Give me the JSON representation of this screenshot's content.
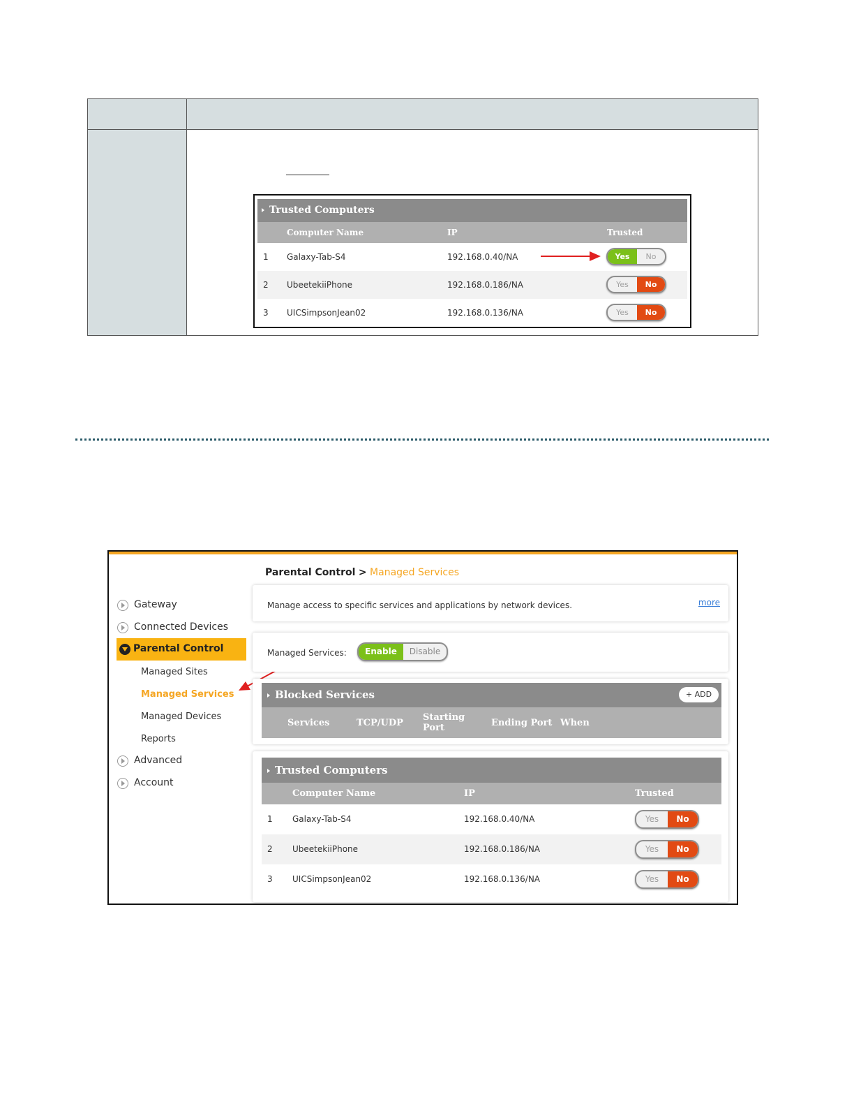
{
  "figure1": {
    "panel_title": "Trusted Computers",
    "columns": [
      "Computer Name",
      "IP",
      "Trusted"
    ],
    "rows": [
      {
        "num": "1",
        "name": "Galaxy-Tab-S4",
        "ip": "192.168.0.40/NA",
        "yes": "Yes",
        "no": "No",
        "trusted": true
      },
      {
        "num": "2",
        "name": "UbeetekiiPhone",
        "ip": "192.168.0.186/NA",
        "yes": "Yes",
        "no": "No",
        "trusted": false
      },
      {
        "num": "3",
        "name": "UICSimpsonJean02",
        "ip": "192.168.0.136/NA",
        "yes": "Yes",
        "no": "No",
        "trusted": false
      }
    ]
  },
  "figure2": {
    "breadcrumb": {
      "parent": "Parental Control",
      "sep": ">",
      "current": "Managed Services"
    },
    "nav": {
      "gateway": "Gateway",
      "connected_devices": "Connected Devices",
      "parental_control": "Parental Control",
      "sub": [
        "Managed Sites",
        "Managed Services",
        "Managed Devices",
        "Reports"
      ],
      "advanced": "Advanced",
      "account": "Account"
    },
    "description": "Manage access to specific services and applications by network devices.",
    "more_link": "more",
    "managed_services_label": "Managed Services:",
    "enable_label": "Enable",
    "disable_label": "Disable",
    "blocked": {
      "title": "Blocked Services",
      "add_label": "+ ADD",
      "columns": [
        "Services",
        "TCP/UDP",
        "Starting Port",
        "Ending Port",
        "When"
      ]
    },
    "trusted": {
      "title": "Trusted Computers",
      "columns": [
        "Computer Name",
        "IP",
        "Trusted"
      ],
      "rows": [
        {
          "num": "1",
          "name": "Galaxy-Tab-S4",
          "ip": "192.168.0.40/NA",
          "yes": "Yes",
          "no": "No",
          "trusted": false
        },
        {
          "num": "2",
          "name": "UbeetekiiPhone",
          "ip": "192.168.0.186/NA",
          "yes": "Yes",
          "no": "No",
          "trusted": false
        },
        {
          "num": "3",
          "name": "UICSimpsonJean02",
          "ip": "192.168.0.136/NA",
          "yes": "Yes",
          "no": "No",
          "trusted": false
        }
      ]
    }
  },
  "colors": {
    "accent": "#f5a623",
    "green": "#7bc019",
    "red": "#e24a13",
    "panel_gray": "#8b8b8b",
    "header_gray": "#b0b0b0",
    "table_header": "#d6dee0",
    "annotation": "#e02020"
  }
}
